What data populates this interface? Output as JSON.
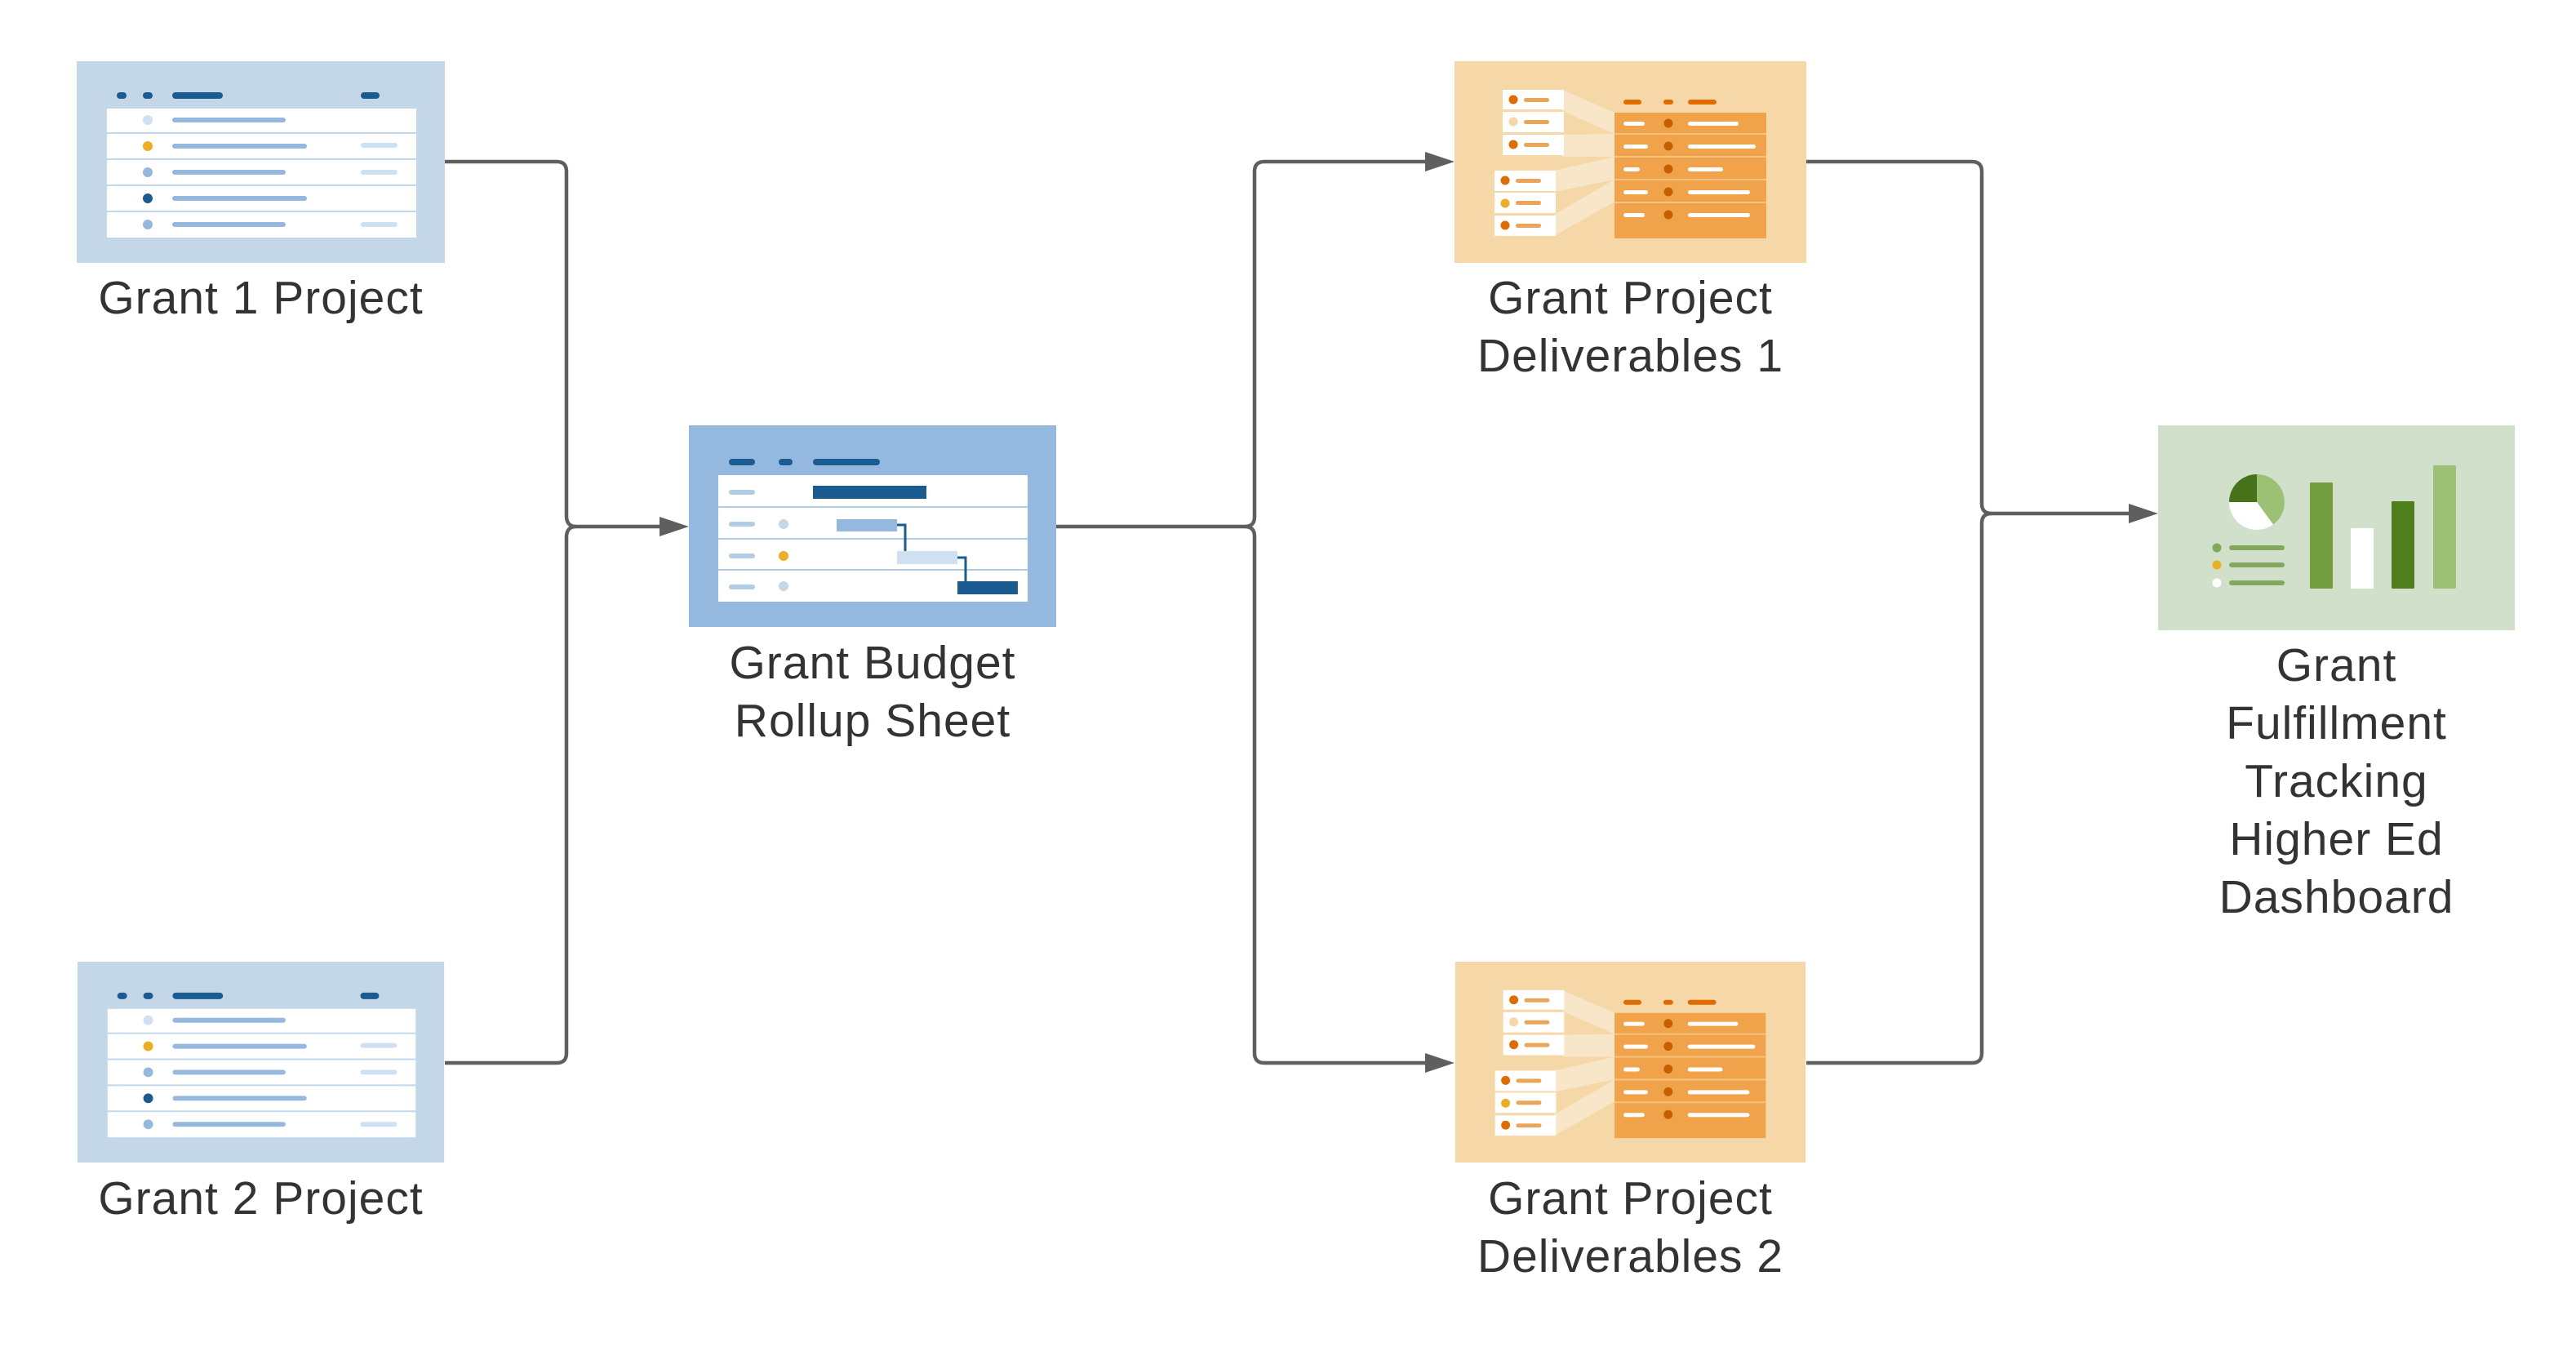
{
  "diagram": {
    "type": "workflow",
    "colors": {
      "connector": "#5f5f5f",
      "sheet_blue_light": "#c3d7e8",
      "sheet_blue": "#95b8de",
      "sheet_dark_blue": "#1a5b91",
      "report_orange_bg": "#f6d7a7",
      "report_orange": "#f0a34a",
      "report_orange_dark": "#e06c00",
      "dashboard_green_bg": "#d1e0ca",
      "dashboard_green": "#729e40",
      "dashboard_green_dark": "#4f7e1f",
      "dashboard_green_light": "#9cc175",
      "accent_yellow": "#ecae22",
      "label_text": "#333333"
    },
    "nodes": [
      {
        "id": "grant1",
        "kind": "sheet",
        "icon": "grid-sheet-icon",
        "label_lines": [
          "Grant 1 Project"
        ]
      },
      {
        "id": "grant2",
        "kind": "sheet",
        "icon": "grid-sheet-icon",
        "label_lines": [
          "Grant 2 Project"
        ]
      },
      {
        "id": "rollup",
        "kind": "gantt-sheet",
        "icon": "gantt-sheet-icon",
        "label_lines": [
          "Grant Budget",
          "Rollup Sheet"
        ]
      },
      {
        "id": "deliv1",
        "kind": "report",
        "icon": "report-icon",
        "label_lines": [
          "Grant Project",
          "Deliverables 1"
        ]
      },
      {
        "id": "deliv2",
        "kind": "report",
        "icon": "report-icon",
        "label_lines": [
          "Grant Project",
          "Deliverables 2"
        ]
      },
      {
        "id": "dashboard",
        "kind": "dashboard",
        "icon": "dashboard-icon",
        "label_lines": [
          "Grant",
          "Fulfillment",
          "Tracking",
          "Higher Ed",
          "Dashboard"
        ]
      }
    ],
    "edges": [
      {
        "from": "grant1",
        "to": "rollup"
      },
      {
        "from": "grant2",
        "to": "rollup"
      },
      {
        "from": "rollup",
        "to": "deliv1"
      },
      {
        "from": "rollup",
        "to": "deliv2"
      },
      {
        "from": "deliv1",
        "to": "dashboard"
      },
      {
        "from": "deliv2",
        "to": "dashboard"
      }
    ]
  }
}
